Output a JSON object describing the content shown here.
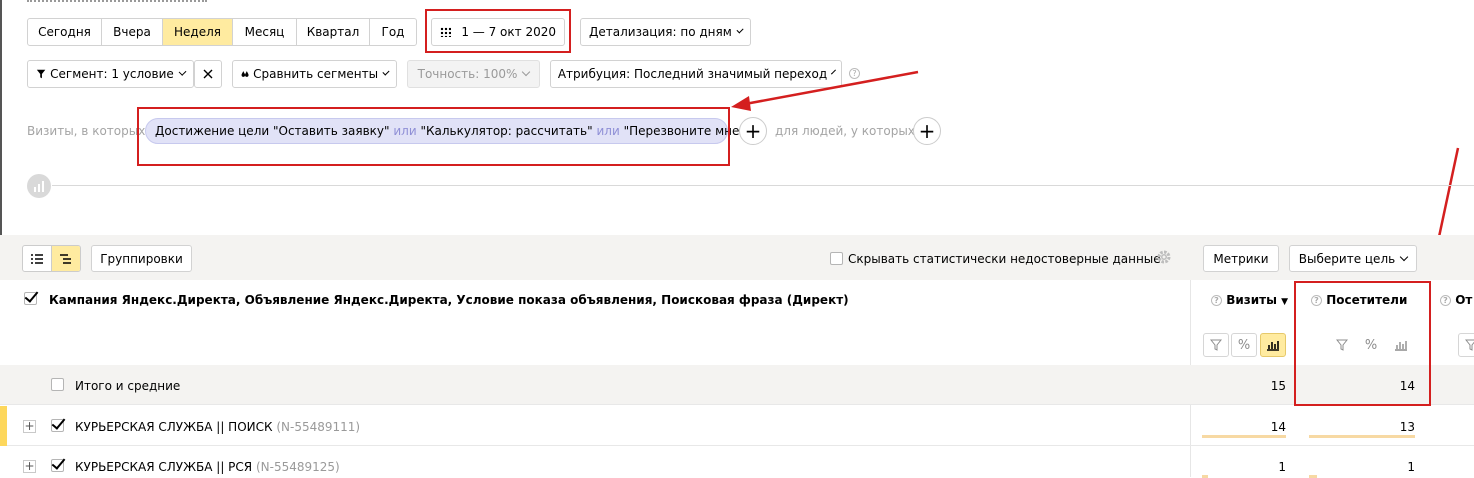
{
  "period_tabs": [
    {
      "label": "Сегодня",
      "active": false
    },
    {
      "label": "Вчера",
      "active": false
    },
    {
      "label": "Неделя",
      "active": true
    },
    {
      "label": "Месяц",
      "active": false
    },
    {
      "label": "Квартал",
      "active": false
    },
    {
      "label": "Год",
      "active": false
    }
  ],
  "date_range": "1 — 7 окт 2020",
  "detail_select": "Детализация: по дням",
  "segment_button": "Сегмент: 1 условие",
  "compare_button": "Сравнить сегменты",
  "accuracy": "Точность: 100%",
  "attribution": "Атрибуция: Последний значимый переход",
  "filter": {
    "prefix": "Визиты, в которых",
    "part1": "Достижение цели \"Оставить заявку\"",
    "or1": "или",
    "part2": "\"Калькулятор: рассчитать\"",
    "or2": "или",
    "part3": "\"Перезвоните мне\"",
    "people_label": "для людей, у которых"
  },
  "toolbar": {
    "groupings_label": "Группировки",
    "hide_unreliable_label": "Скрывать статистически недостоверные данные",
    "metrics_label": "Метрики",
    "goal_select": "Выберите цель"
  },
  "table": {
    "dimension_header": "Кампания Яндекс.Директа, Объявление Яндекс.Директа, Условие показа объявления, Поисковая фраза (Директ)",
    "col_visits": "Визиты",
    "col_visitors": "Посетители",
    "col_next": "От",
    "totals_label": "Итого и средние",
    "totals": {
      "visits": "15",
      "visitors": "14"
    },
    "rows": [
      {
        "name": "КУРЬЕРСКАЯ СЛУЖБА || ПОИСК",
        "id": "(N-55489111)",
        "visits": "14",
        "visitors": "13"
      },
      {
        "name": "КУРЬЕРСКАЯ СЛУЖБА || РСЯ",
        "id": "(N-55489125)",
        "visits": "1",
        "visitors": "1"
      }
    ]
  },
  "colors": {
    "accent": "#ffeba0",
    "annotation": "#d41f1f",
    "row_highlight": "#fdd75c"
  }
}
